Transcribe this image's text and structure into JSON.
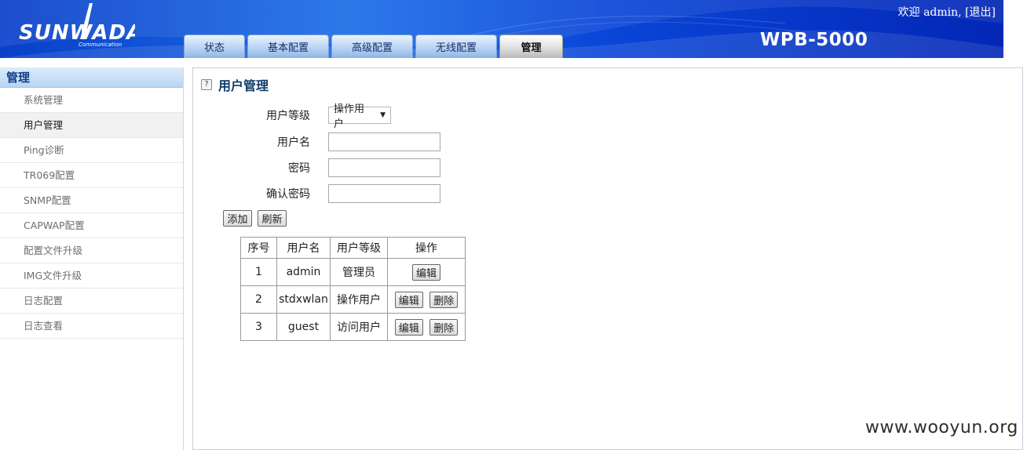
{
  "header": {
    "logo_text": "SUNWADA",
    "logo_sub": "Communication",
    "welcome": "欢迎 admin, [退出]",
    "model": "WPB-5000",
    "tabs": [
      {
        "label": "状态",
        "active": false
      },
      {
        "label": "基本配置",
        "active": false
      },
      {
        "label": "高级配置",
        "active": false
      },
      {
        "label": "无线配置",
        "active": false
      },
      {
        "label": "管理",
        "active": true
      }
    ]
  },
  "sidebar": {
    "heading": "管理",
    "items": [
      {
        "label": "系统管理",
        "active": false
      },
      {
        "label": "用户管理",
        "active": true
      },
      {
        "label": "Ping诊断",
        "active": false
      },
      {
        "label": "TR069配置",
        "active": false
      },
      {
        "label": "SNMP配置",
        "active": false
      },
      {
        "label": "CAPWAP配置",
        "active": false
      },
      {
        "label": "配置文件升级",
        "active": false
      },
      {
        "label": "IMG文件升级",
        "active": false
      },
      {
        "label": "日志配置",
        "active": false
      },
      {
        "label": "日志查看",
        "active": false
      }
    ]
  },
  "main": {
    "help_icon_text": "?",
    "title": "用户管理",
    "form": {
      "level_label": "用户等级",
      "level_value": "操作用户",
      "username_label": "用户名",
      "username_value": "",
      "password_label": "密码",
      "password_value": "",
      "confirm_label": "确认密码",
      "confirm_value": ""
    },
    "buttons": {
      "add": "添加",
      "refresh": "刷新"
    },
    "table": {
      "headers": [
        "序号",
        "用户名",
        "用户等级",
        "操作"
      ],
      "rows": [
        {
          "index": "1",
          "username": "admin",
          "level": "管理员",
          "edit": "编辑",
          "delete": ""
        },
        {
          "index": "2",
          "username": "stdxwlan",
          "level": "操作用户",
          "edit": "编辑",
          "delete": "删除"
        },
        {
          "index": "3",
          "username": "guest",
          "level": "访问用户",
          "edit": "编辑",
          "delete": "删除"
        }
      ]
    }
  },
  "watermark": "www.wooyun.org",
  "colors": {
    "header_blue": "#0a3fc9",
    "title_text": "#0f3b6a",
    "sidebar_head": "#b8d5f4"
  }
}
